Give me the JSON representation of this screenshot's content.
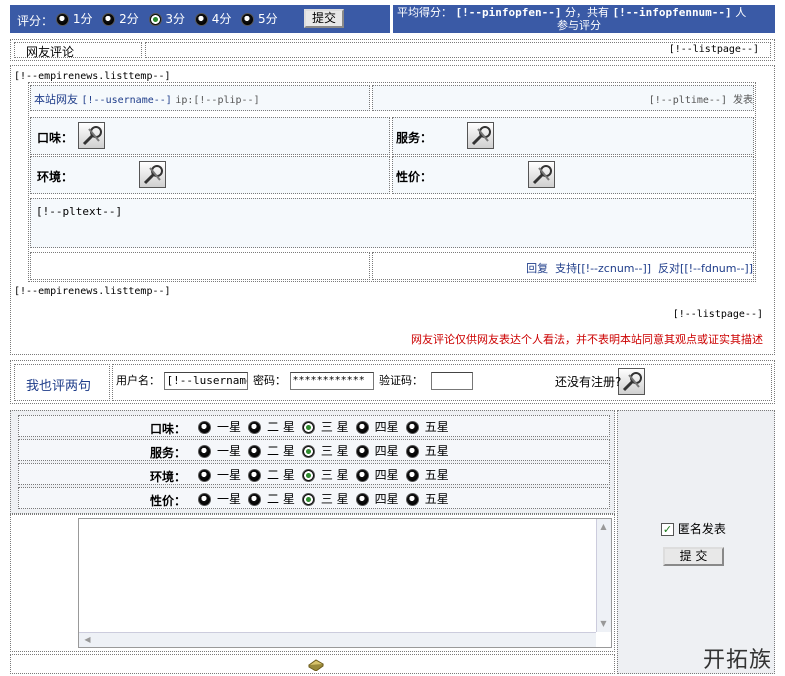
{
  "top_bar": {
    "rate_label": "评分：",
    "options": [
      "1分",
      "2分",
      "3分",
      "4分",
      "5分"
    ],
    "selected_index": 2,
    "submit_label": "提交",
    "avg_prefix": "平均得分：",
    "avg_value": "[!--pinfopfen--]",
    "avg_mid": "分，共有",
    "count_value": "[!--infopfennum--]",
    "count_suffix": "人",
    "count_suffix2": "参与评分"
  },
  "comments": {
    "title": "网友评论",
    "listpage_top": "[!--listpage--]",
    "listtemp_start": "[!--empirenews.listtemp--]",
    "user_prefix": "本站网友",
    "username": "[!--username--]",
    "ip_text": "ip:[!--plip--]",
    "time_text": "[!--pltime--] 发表",
    "ratings": {
      "taste_label": "口味：",
      "service_label": "服务：",
      "environment_label": "环境：",
      "price_label": "性价："
    },
    "pltext": "[!--pltext--]",
    "reply_label": "回复",
    "support_label": "支持[[!--zcnum--]]",
    "oppose_label": "反对[[!--fdnum--]]",
    "listtemp_end": "[!--empirenews.listtemp--]",
    "listpage_bottom": "[!--listpage--]",
    "disclaimer": "网友评论仅供网友表达个人看法，并不表明本站同意其观点或证实其描述"
  },
  "form": {
    "title": "我也评两句",
    "username_label": "用户名：",
    "username_value": "[!--lusername--]",
    "password_label": "密码：",
    "password_value": "************",
    "captcha_label": "验证码：",
    "register_text": "还没有注册?",
    "rating_rows": [
      {
        "label": "口味：",
        "selected_index": 2
      },
      {
        "label": "服务：",
        "selected_index": 2
      },
      {
        "label": "环境：",
        "selected_index": 2
      },
      {
        "label": "性价：",
        "selected_index": 2
      }
    ],
    "star_options": [
      "一星",
      "二 星",
      "三 星",
      "四星",
      "五星"
    ],
    "anonymous_label": "匿名发表",
    "anonymous_checked": true,
    "submit_label": "提 交"
  },
  "watermark": "开拓族",
  "colors": {
    "header_bar": "#3a5aa6",
    "disclaimer": "#cc0000",
    "form_title": "#1f3d8a"
  }
}
